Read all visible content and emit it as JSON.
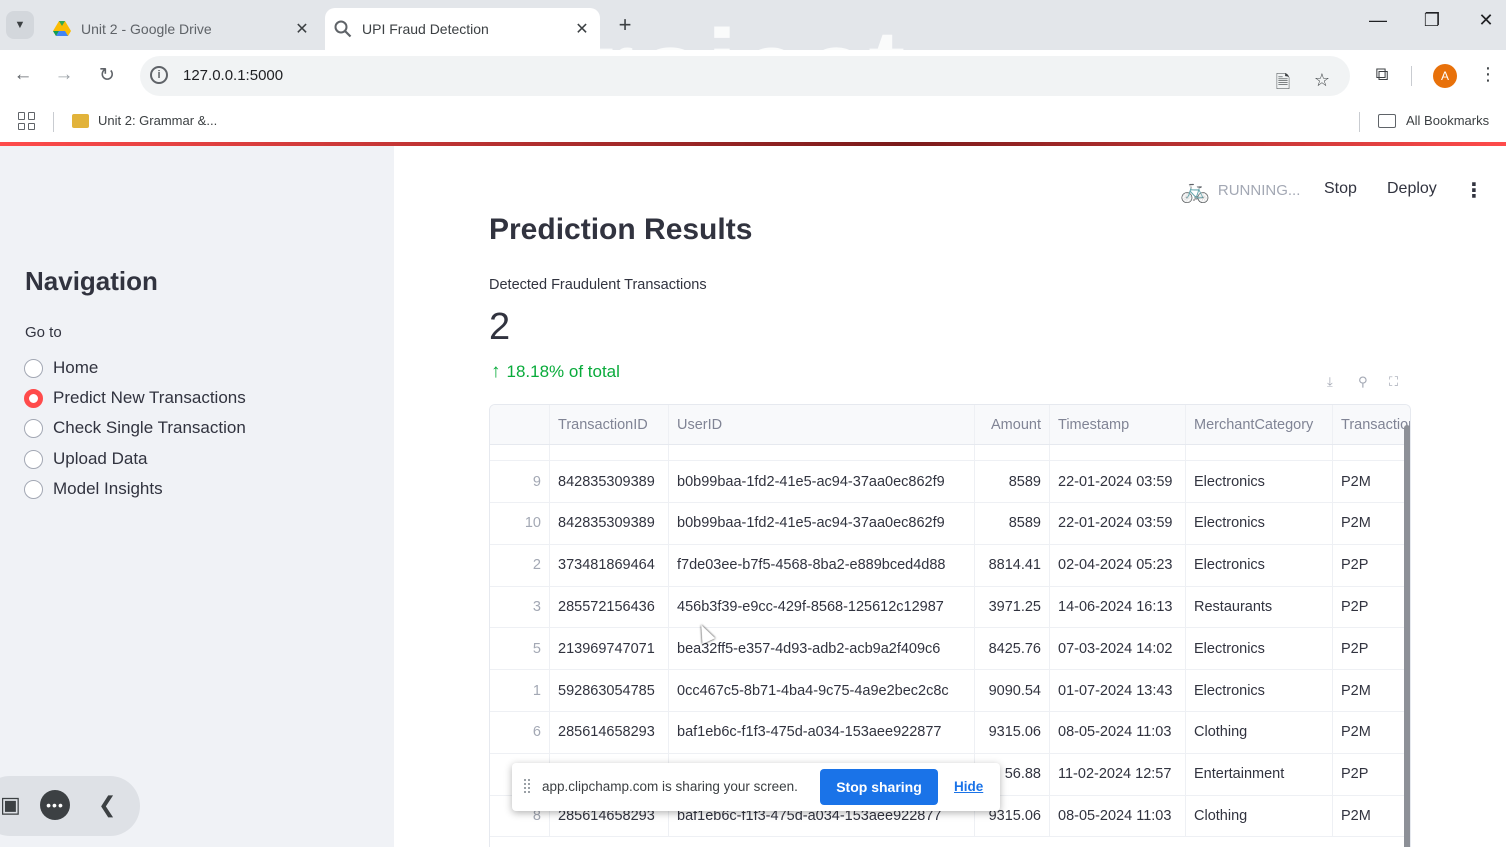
{
  "browser": {
    "tabs": [
      {
        "title": "Unit 2 - Google Drive",
        "active": false
      },
      {
        "title": "UPI Fraud Detection",
        "active": true
      }
    ],
    "url": "127.0.0.1:5000",
    "bookmark": "Unit 2: Grammar &...",
    "all_bookmarks": "All Bookmarks",
    "profile_initial": "A",
    "watermark": "project"
  },
  "sidebar": {
    "title": "Navigation",
    "goto_label": "Go to",
    "options": [
      {
        "label": "Home",
        "selected": false
      },
      {
        "label": "Predict New Transactions",
        "selected": true
      },
      {
        "label": "Check Single Transaction",
        "selected": false
      },
      {
        "label": "Upload Data",
        "selected": false
      },
      {
        "label": "Model Insights",
        "selected": false
      }
    ]
  },
  "header": {
    "status": "RUNNING...",
    "stop": "Stop",
    "deploy": "Deploy"
  },
  "main": {
    "title": "Prediction Results",
    "metric": {
      "label": "Detected Fraudulent Transactions",
      "value": "2",
      "delta": "18.18% of total",
      "delta_color": "#09ab3b"
    },
    "table": {
      "columns": [
        "",
        "TransactionID",
        "UserID",
        "Amount",
        "Timestamp",
        "MerchantCategory",
        "TransactionType"
      ],
      "rows": [
        [
          "9",
          "842835309389",
          "b0b99baa-1fd2-41e5-ac94-37aa0ec862f9",
          "8589",
          "22-01-2024 03:59",
          "Electronics",
          "P2M"
        ],
        [
          "10",
          "842835309389",
          "b0b99baa-1fd2-41e5-ac94-37aa0ec862f9",
          "8589",
          "22-01-2024 03:59",
          "Electronics",
          "P2M"
        ],
        [
          "2",
          "373481869464",
          "f7de03ee-b7f5-4568-8ba2-e889bced4d88",
          "8814.41",
          "02-04-2024 05:23",
          "Electronics",
          "P2P"
        ],
        [
          "3",
          "285572156436",
          "456b3f39-e9cc-429f-8568-125612c12987",
          "3971.25",
          "14-06-2024 16:13",
          "Restaurants",
          "P2P"
        ],
        [
          "5",
          "213969747071",
          "bea32ff5-e357-4d93-adb2-acb9a2f409c6",
          "8425.76",
          "07-03-2024 14:02",
          "Electronics",
          "P2P"
        ],
        [
          "1",
          "592863054785",
          "0cc467c5-8b71-4ba4-9c75-4a9e2bec2c8c",
          "9090.54",
          "01-07-2024 13:43",
          "Electronics",
          "P2M"
        ],
        [
          "6",
          "285614658293",
          "baf1eb6c-f1f3-475d-a034-153aee922877",
          "9315.06",
          "08-05-2024 11:03",
          "Clothing",
          "P2M"
        ],
        [
          "",
          "",
          "",
          "56.88",
          "11-02-2024 12:57",
          "Entertainment",
          "P2P"
        ],
        [
          "8",
          "285614658293",
          "baf1eb6c-f1f3-475d-a034-153aee922877",
          "9315.06",
          "08-05-2024 11:03",
          "Clothing",
          "P2M"
        ]
      ]
    }
  },
  "sharebar": {
    "message": "app.clipchamp.com is sharing your screen.",
    "stop_label": "Stop sharing",
    "hide_label": "Hide"
  }
}
